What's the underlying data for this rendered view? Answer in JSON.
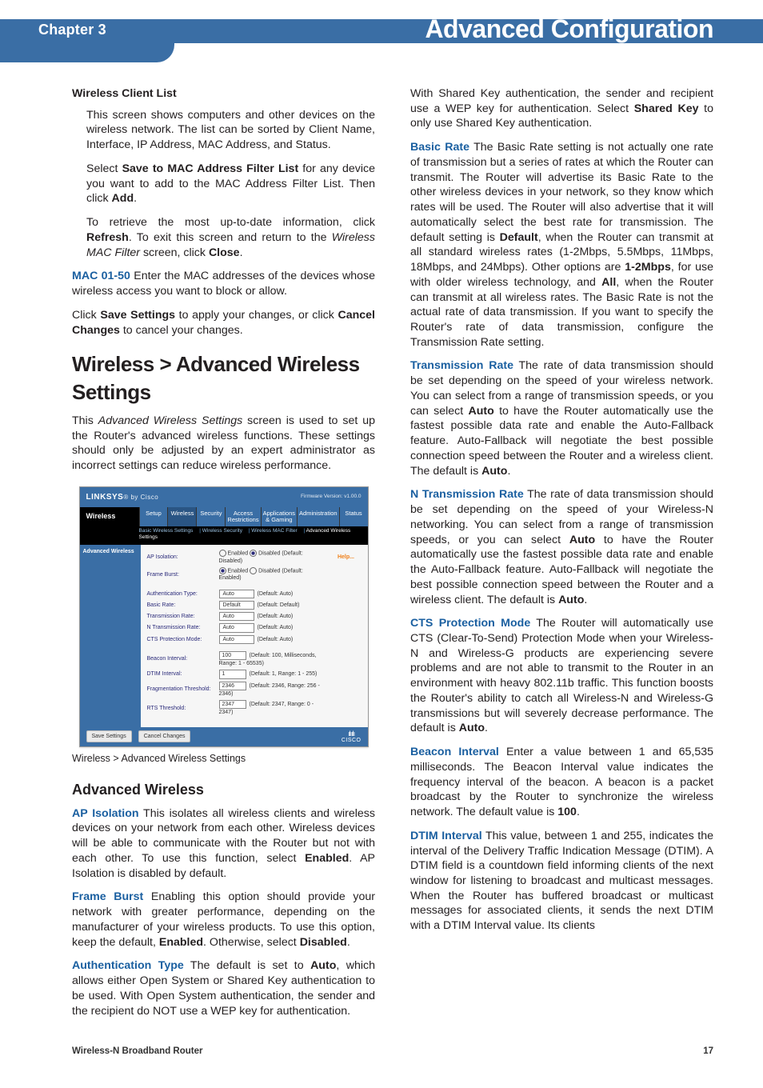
{
  "header": {
    "chapter": "Chapter 3",
    "title": "Advanced Configuration"
  },
  "left": {
    "wcl_heading": "Wireless Client List",
    "wcl_p1": "This screen shows computers and other devices on the wireless network. The list can be sorted by Client Name, Interface, IP Address, MAC Address, and Status.",
    "wcl_p2a": "Select ",
    "wcl_p2b": "Save to MAC Address Filter List",
    "wcl_p2c": " for any device you want to add to the MAC Address Filter List. Then click ",
    "wcl_p2d": "Add",
    "wcl_p2e": ".",
    "wcl_p3a": "To retrieve the most up-to-date information, click ",
    "wcl_p3b": "Refresh",
    "wcl_p3c": ". To exit this screen and return to the ",
    "wcl_p3d": "Wireless MAC Filter",
    "wcl_p3e": " screen, click ",
    "wcl_p3f": "Close",
    "wcl_p3g": ".",
    "mac_label": "MAC 01-50",
    "mac_text": " Enter the MAC addresses of the devices whose wireless access you want to block or allow.",
    "save_a": "Click ",
    "save_b": "Save Settings",
    "save_c": " to apply your changes, or click ",
    "save_d": "Cancel Changes",
    "save_e": " to cancel your changes.",
    "section_heading": "Wireless > Advanced Wireless Settings",
    "section_p1a": "This ",
    "section_p1b": "Advanced Wireless Settings",
    "section_p1c": " screen is used to set up the Router's advanced wireless functions. These settings should only be adjusted by an expert administrator as incorrect settings can reduce wireless performance.",
    "figure_caption": "Wireless > Advanced Wireless Settings",
    "adv_heading": "Advanced Wireless",
    "ap_label": "AP Isolation",
    "ap_text_a": "  This isolates all wireless clients and wireless devices on your network from each other. Wireless devices will be able to communicate with the Router but not with each other. To use this function, select ",
    "ap_text_b": "Enabled",
    "ap_text_c": ". AP Isolation is disabled by default.",
    "fb_label": "Frame Burst",
    "fb_text_a": "  Enabling this option should provide your network with greater performance, depending on the manufacturer of your wireless products. To use this option, keep the default, ",
    "fb_text_b": "Enabled",
    "fb_text_c": ". Otherwise, select ",
    "fb_text_d": "Disabled",
    "fb_text_e": ".",
    "auth_label": "Authentication Type",
    "auth_text_a": "  The default is set to ",
    "auth_text_b": "Auto",
    "auth_text_c": ", which allows either Open System or Shared Key authentication to be used. With Open System authentication, the sender and the recipient do NOT use a WEP key for authentication."
  },
  "right": {
    "shared_a": "With Shared Key authentication, the sender and recipient use a WEP key for authentication. Select ",
    "shared_b": "Shared Key",
    "shared_c": " to only use Shared Key authentication.",
    "br_label": "Basic Rate",
    "br_a": "  The Basic Rate setting is not actually one rate of transmission but a series of rates at which the Router can transmit. The Router will advertise its Basic Rate to the other wireless devices in your network, so they know which rates will be used. The Router will also advertise that it will automatically select the best rate for transmission. The default setting is ",
    "br_b": "Default",
    "br_c": ", when the Router can transmit at all standard wireless rates (1-2Mbps, 5.5Mbps, 11Mbps, 18Mbps, and 24Mbps). Other options are ",
    "br_d": "1-2Mbps",
    "br_e": ", for use with older wireless technology, and ",
    "br_f": "All",
    "br_g": ", when the Router can transmit at all wireless rates. The Basic Rate is not the actual rate of data transmission. If you want to specify the Router's rate of data transmission, configure the Transmission Rate setting.",
    "tr_label": "Transmission Rate",
    "tr_a": "  The rate of data transmission should be set depending on the speed of your wireless network. You can select from a range of transmission speeds, or you can select ",
    "tr_b": "Auto",
    "tr_c": " to have the Router automatically use the fastest possible data rate and enable the Auto-Fallback feature. Auto-Fallback will negotiate the best possible connection speed between the Router and a wireless client. The default is ",
    "tr_d": "Auto",
    "tr_e": ".",
    "ntr_label": "N Transmission Rate",
    "ntr_a": " The rate of data transmission should be set depending on the speed of your Wireless-N networking. You can select from a range of transmission speeds, or you can select ",
    "ntr_b": "Auto",
    "ntr_c": " to have the Router automatically use the fastest possible data rate and enable the Auto-Fallback feature. Auto-Fallback will negotiate the best possible connection speed between the Router and a wireless client. The default is ",
    "ntr_d": "Auto",
    "ntr_e": ".",
    "cts_label": "CTS Protection Mode",
    "cts_a": " The Router will automatically use CTS (Clear-To-Send) Protection Mode when your Wireless-N and Wireless-G products are experiencing severe problems and are not able to transmit to the Router in an environment with heavy 802.11b traffic. This function boosts the Router's ability to catch all Wireless-N and Wireless-G transmissions but will severely decrease performance. The default is ",
    "cts_b": "Auto",
    "cts_c": ".",
    "bi_label": "Beacon Interval",
    "bi_a": " Enter a value between 1 and 65,535 milliseconds. The Beacon Interval value indicates the frequency interval of the beacon. A beacon is a packet broadcast by the Router to synchronize the wireless network. The default value is ",
    "bi_b": "100",
    "bi_c": ".",
    "dtim_label": "DTIM Interval",
    "dtim_a": "  This value, between 1 and 255, indicates the interval of the Delivery Traffic Indication Message (DTIM). A DTIM field is a countdown field informing clients of the next window for listening to broadcast and multicast messages. When the Router has buffered broadcast or multicast messages for associated clients, it sends the next DTIM with a DTIM Interval value. Its clients"
  },
  "figure": {
    "logo_main": "LINKSYS",
    "logo_by": "by Cisco",
    "fw": "Firmware Version: v1.00.0",
    "section_label": "Wireless",
    "tabs": [
      "Setup",
      "Wireless",
      "Security",
      "Access Restrictions",
      "Applications & Gaming",
      "Administration",
      "Status"
    ],
    "subtabs_a": "Basic Wireless Settings",
    "subtabs_b": "Wireless Security",
    "subtabs_c": "Wireless MAC Filter",
    "subtabs_sel": "Advanced Wireless Settings",
    "side_label": "Advanced Wireless",
    "help": "Help...",
    "rows": {
      "ap_k": "AP Isolation:",
      "ap_en": "Enabled",
      "ap_dis": "Disabled",
      "ap_def": "(Default: Disabled)",
      "fb_k": "Frame Burst:",
      "fb_en": "Enabled",
      "fb_dis": "Disabled",
      "fb_def": "(Default: Enabled)",
      "auth_k": "Authentication Type:",
      "auth_v": "Auto",
      "auth_def": "(Default: Auto)",
      "br_k": "Basic Rate:",
      "br_v": "Default",
      "br_def": "(Default: Default)",
      "tr_k": "Transmission Rate:",
      "tr_v": "Auto",
      "tr_def": "(Default: Auto)",
      "ntr_k": "N Transmission Rate:",
      "ntr_v": "Auto",
      "ntr_def": "(Default: Auto)",
      "cts_k": "CTS Protection Mode:",
      "cts_v": "Auto",
      "cts_def": "(Default: Auto)",
      "bi_k": "Beacon Interval:",
      "bi_v": "100",
      "bi_def": "(Default: 100, Milliseconds, Range: 1 - 65535)",
      "dt_k": "DTIM Interval:",
      "dt_v": "1",
      "dt_def": "(Default: 1, Range: 1 - 255)",
      "ft_k": "Fragmentation Threshold:",
      "ft_v": "2346",
      "ft_def": "(Default: 2346, Range: 256 - 2346)",
      "rts_k": "RTS Threshold:",
      "rts_v": "2347",
      "rts_def": "(Default: 2347, Range: 0 - 2347)"
    },
    "btn_save": "Save Settings",
    "btn_cancel": "Cancel Changes",
    "cisco_bars": "ılıılı",
    "cisco": "CISCO"
  },
  "footer": {
    "product": "Wireless-N Broadband Router",
    "page": "17"
  }
}
